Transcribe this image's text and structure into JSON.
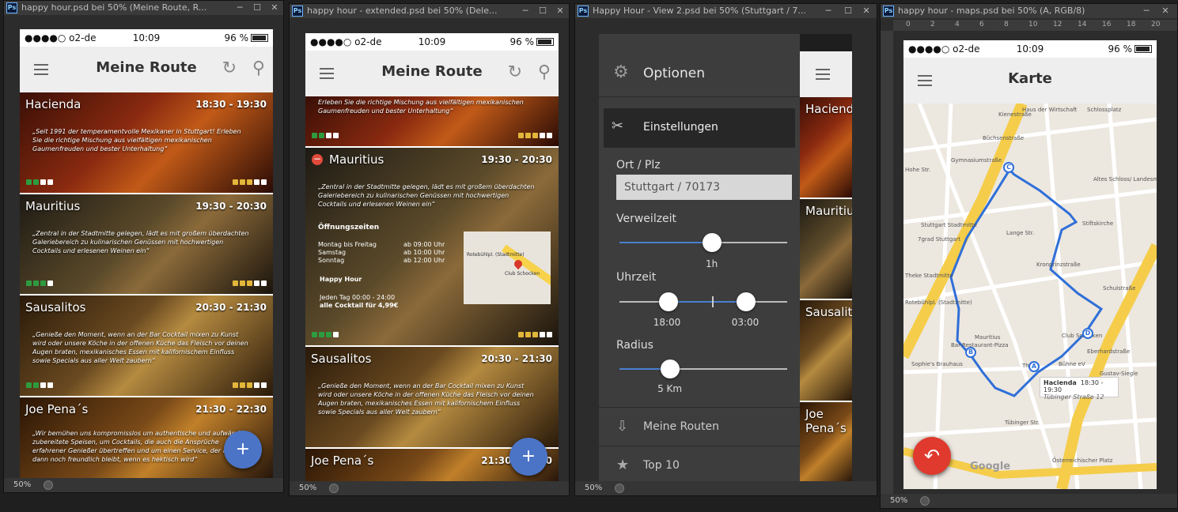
{
  "windows": [
    {
      "title": "happy hour.psd bei 50% (Meine Route, R...",
      "zoom": "50%"
    },
    {
      "title": "happy hour - extended.psd bei 50% (Dele...",
      "zoom": "50%"
    },
    {
      "title": "Happy Hour - View 2.psd bei 50% (Stuttgart / 7...",
      "zoom": "50%"
    },
    {
      "title": "happy hour - maps.psd bei 50% (A, RGB/8)",
      "zoom": "50%"
    }
  ],
  "statusbar": {
    "carrier": "●●●●○ o2-de",
    "time": "10:09",
    "battery": "96 %"
  },
  "route": {
    "title": "Meine Route",
    "cards": [
      {
        "name": "Hacienda",
        "time": "18:30 - 19:30",
        "desc": "„Seit 1991 der temperamentvolle Mexikaner in Stuttgart! Erleben Sie die richtige Mischung aus vielfältigen mexikanischen Gaumenfreuden und bester Unterhaltung“"
      },
      {
        "name": "Mauritius",
        "time": "19:30 - 20:30",
        "desc": "„Zentral in der Stadtmitte gelegen, lädt es mit großem überdachten Galeriebereich zu kulinarischen Genüssen mit hochwertigen Cocktails und erlesenen Weinen ein“"
      },
      {
        "name": "Sausalitos",
        "time": "20:30 - 21:30",
        "desc": "„Genieße den Moment, wenn an der Bar Cocktail mixen zu Kunst wird oder unsere Köche in der offenen Küche das Fleisch vor deinen Augen braten, mexikanisches Essen mit kalifornischem Einfluss sowie Specials aus aller Welt zaubern“"
      },
      {
        "name": "Joe Pena´s",
        "time": "21:30 - 22:30",
        "desc": "„Wir bemühen uns kompromisslos um authentische und aufwändig zubereitete Speisen, um Cocktails, die auch die Ansprüche erfahrener Genießer übertreffen und um einen Service, der auch dann noch freundlich bleibt, wenn es hektisch wird“"
      }
    ],
    "fab": "+"
  },
  "extended": {
    "top_desc": "Erleben Sie die richtige Mischung aus vielfältigen mexikanischen Gaumenfreuden und bester Unterhaltung“",
    "mauritius": {
      "name": "Mauritius",
      "time": "19:30 - 20:30",
      "desc": "„Zentral in der Stadtmitte gelegen, lädt es mit großem überdachten Galeriebereich zu kulinarischen Genüssen mit hochwertigen Cocktails und erlesenen Weinen ein“",
      "hours_title": "Öffnungszeiten",
      "hours": [
        {
          "day": "Montag bis Freitag",
          "time": "ab 09:00 Uhr"
        },
        {
          "day": "Samstag",
          "time": "ab 10:00 Uhr"
        },
        {
          "day": "Sonntag",
          "time": "ab 12:00 Uhr"
        }
      ],
      "hh_title": "Happy Hour",
      "hh_line1": "Jeden Tag 00:00 - 24:00",
      "hh_line2": "alle Cocktail für 4,99€",
      "map_label1": "Rotebühlpl. (Stadtmitte)",
      "map_label2": "Club Schocken"
    }
  },
  "options": {
    "header": "Optionen",
    "einstellungen": "Einstellungen",
    "ort_label": "Ort / Plz",
    "ort_value": "Stuttgart / 70173",
    "verweil_label": "Verweilzeit",
    "verweil_value": "1h",
    "verweil_level": 0.55,
    "uhrzeit_label": "Uhrzeit",
    "uhrzeit_from": "18:00",
    "uhrzeit_to": "03:00",
    "radius_label": "Radius",
    "radius_value": "5 Km",
    "radius_level": 0.3,
    "menu": [
      {
        "label": "Meine Routen",
        "icon": "download-icon"
      },
      {
        "label": "Top 10",
        "icon": "star-icon"
      }
    ],
    "peek_cards": [
      "Hacienda",
      "Mauritius",
      "Sausalito",
      "Joe Pena´s"
    ]
  },
  "maps": {
    "title": "Karte",
    "labels": [
      "Haus der Wirtschaft",
      "Schlossplatz",
      "Büchsenstraße",
      "Gymnasiumstraße",
      "Hohe Str.",
      "Lange Str.",
      "Stuttgart Stadtmitte",
      "7grad Stuttgart",
      "Stiftskirche",
      "Altes Schloss/ Landesmuseum",
      "Kronprinzstraße",
      "Rotebühlpl. (Stadtmitte)",
      "Mauritius",
      "Bar-Restaurant-Pizza",
      "Sophie's Brauhaus",
      "Club Schocken",
      "Eberhardstraße",
      "Thea",
      "Bühne eV",
      "Gustav-Siegle",
      "Tübinger Str.",
      "Österreichischer Platz",
      "Schulstraße",
      "Kienestraße",
      "Theke Stadtmitte"
    ],
    "popup_name": "Hacienda",
    "popup_time": "18:30 - 19:30",
    "popup_addr": "Tübinger Straße 12",
    "markers": [
      "A",
      "B",
      "C",
      "D"
    ],
    "google": "Google",
    "ruler": [
      "0",
      "2",
      "4",
      "6",
      "8",
      "10",
      "12",
      "14",
      "16",
      "18",
      "20"
    ]
  }
}
